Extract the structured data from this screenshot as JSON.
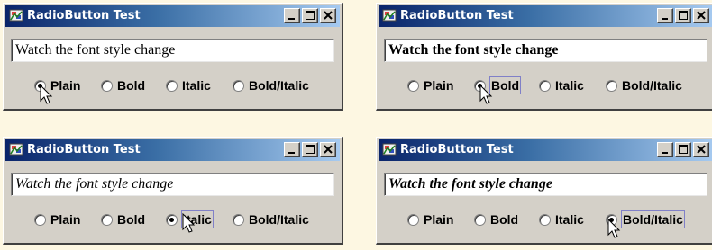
{
  "windows": [
    {
      "title": "RadioButton Test",
      "text_value": "Watch the font style change",
      "font_style": "plain",
      "options": [
        "Plain",
        "Bold",
        "Italic",
        "Bold/Italic"
      ],
      "selected": "Plain"
    },
    {
      "title": "RadioButton Test",
      "text_value": "Watch the font style change",
      "font_style": "bold",
      "options": [
        "Plain",
        "Bold",
        "Italic",
        "Bold/Italic"
      ],
      "selected": "Bold"
    },
    {
      "title": "RadioButton Test",
      "text_value": "Watch the font style change",
      "font_style": "italic",
      "options": [
        "Plain",
        "Bold",
        "Italic",
        "Bold/Italic"
      ],
      "selected": "Italic"
    },
    {
      "title": "RadioButton Test",
      "text_value": "Watch the font style change",
      "font_style": "bold-italic",
      "options": [
        "Plain",
        "Bold",
        "Italic",
        "Bold/Italic"
      ],
      "selected": "Bold/Italic"
    }
  ],
  "colors": {
    "titlebar_start": "#0a246a",
    "titlebar_end": "#a6caf0",
    "window_bg": "#d4d0c8",
    "page_bg": "#fdf7e2"
  },
  "icons": [
    "app-icon",
    "minimize-icon",
    "maximize-icon",
    "close-icon",
    "mouse-cursor-icon"
  ]
}
